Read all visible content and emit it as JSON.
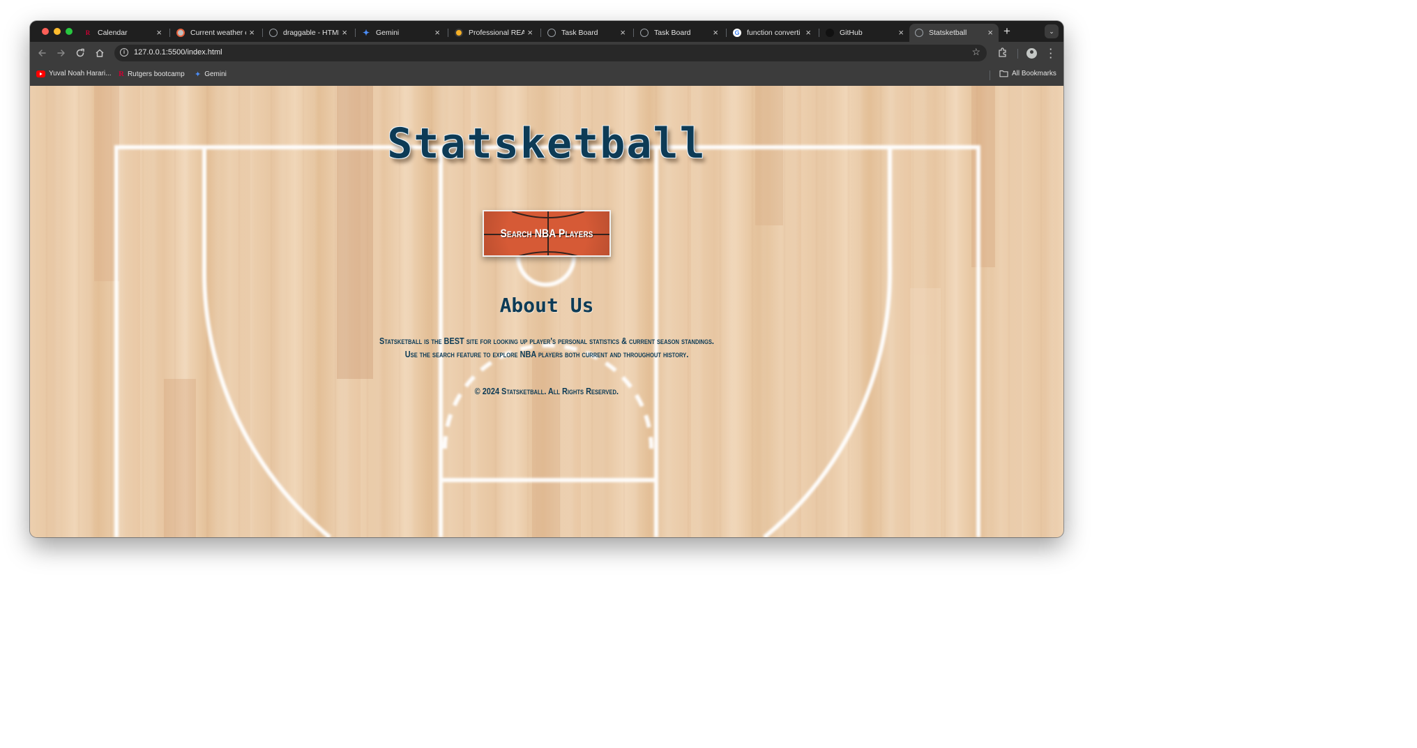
{
  "browser": {
    "tabs": [
      {
        "title": "Calendar",
        "icon": "rutgers-r-icon",
        "active": false
      },
      {
        "title": "Current weather c",
        "icon": "weather-app-icon",
        "active": false
      },
      {
        "title": "draggable - HTML",
        "icon": "globe-icon",
        "active": false
      },
      {
        "title": "Gemini",
        "icon": "gemini-sparkle-icon",
        "active": false
      },
      {
        "title": "Professional REAL",
        "icon": "real-site-icon",
        "active": false
      },
      {
        "title": "Task Board",
        "icon": "globe-icon",
        "active": false
      },
      {
        "title": "Task Board",
        "icon": "globe-icon",
        "active": false
      },
      {
        "title": "function converti",
        "icon": "google-g-icon",
        "active": false
      },
      {
        "title": "GitHub",
        "icon": "github-icon",
        "active": false
      },
      {
        "title": "Statsketball",
        "icon": "globe-icon",
        "active": true
      }
    ],
    "new_tab_label": "+",
    "tab_search_label": "⌄",
    "address_bar": {
      "url": "127.0.0.1:5500/index.html"
    },
    "bookmarks": [
      {
        "label": "Yuval Noah Harari...",
        "icon": "youtube-icon"
      },
      {
        "label": "Rutgers bootcamp",
        "icon": "rutgers-r-icon"
      },
      {
        "label": "Gemini",
        "icon": "gemini-sparkle-icon"
      }
    ],
    "all_bookmarks_label": "All Bookmarks"
  },
  "page": {
    "title": "Statsketball",
    "search_button_label": "Search NBA Players",
    "about_heading": "About Us",
    "about_lines": [
      "Statsketball is the BEST site for looking up player's personal statistics & current season standings.",
      "Use the search feature to explore NBA players both current and throughout history."
    ],
    "footer": "© 2024 Statsketball. All Rights Reserved."
  },
  "colors": {
    "title_text": "#0d3b56",
    "button_orange": "#d65a36",
    "court_wood": "#ecd0ae",
    "court_lines": "#ffffff"
  }
}
